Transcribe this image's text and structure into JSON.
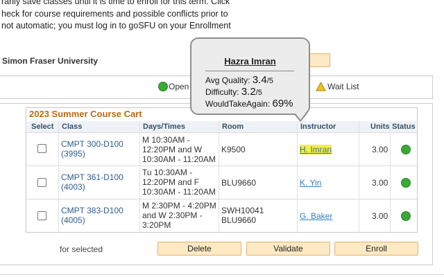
{
  "intro": {
    "lines": [
      "rarily save classes until it is time to enroll for this term. Click",
      "heck for course requirements and possible conflicts prior to",
      "not automatic; you must log in to goSFU on your Enrollment"
    ]
  },
  "university": "Simon Fraser University",
  "legend": {
    "open_label": "Open",
    "waitlist_label": "Wait List",
    "open_color": "#3aaa35",
    "waitlist_color": "#f0c419"
  },
  "cart": {
    "title": "2023 Summer Course Cart",
    "headers": {
      "select": "Select",
      "class": "Class",
      "days_times": "Days/Times",
      "room": "Room",
      "instructor": "Instructor",
      "units": "Units",
      "status": "Status"
    },
    "rows": [
      {
        "class_line1": "CMPT 300-D100",
        "class_line2": "(3995)",
        "times": [
          "M 10:30AM -",
          "12:20PM and  W",
          "10:30AM - 11:20AM"
        ],
        "room": [
          "K9500"
        ],
        "instructor": "H. Imran",
        "units": "3.00",
        "status": "Open"
      },
      {
        "class_line1": "CMPT 361-D100",
        "class_line2": "(4003)",
        "times": [
          "Tu 10:30AM -",
          "12:20PM and  F",
          "10:30AM - 11:20AM"
        ],
        "room": [
          "BLU9660"
        ],
        "instructor": "K. Yin",
        "units": "3.00",
        "status": "Open"
      },
      {
        "class_line1": "CMPT 383-D100",
        "class_line2": "(4005)",
        "times": [
          "M 2:30PM - 4:20PM",
          "and  W 2:30PM -",
          "3:20PM"
        ],
        "room": [
          "SWH10041",
          "BLU9660"
        ],
        "instructor": "G. Baker",
        "units": "3.00",
        "status": "Open"
      }
    ]
  },
  "footer": {
    "for_selected": "for selected",
    "delete": "Delete",
    "validate": "Validate",
    "enroll": "Enroll"
  },
  "tooltip": {
    "name": "Hazra Imran",
    "quality_label": "Avg Quality:",
    "quality_value": "3.4",
    "quality_suffix": "/5",
    "difficulty_label": "Difficulty:",
    "difficulty_value": "3.2",
    "difficulty_suffix": "/5",
    "wta_label": "WouldTakeAgain:",
    "wta_value": "69%"
  }
}
